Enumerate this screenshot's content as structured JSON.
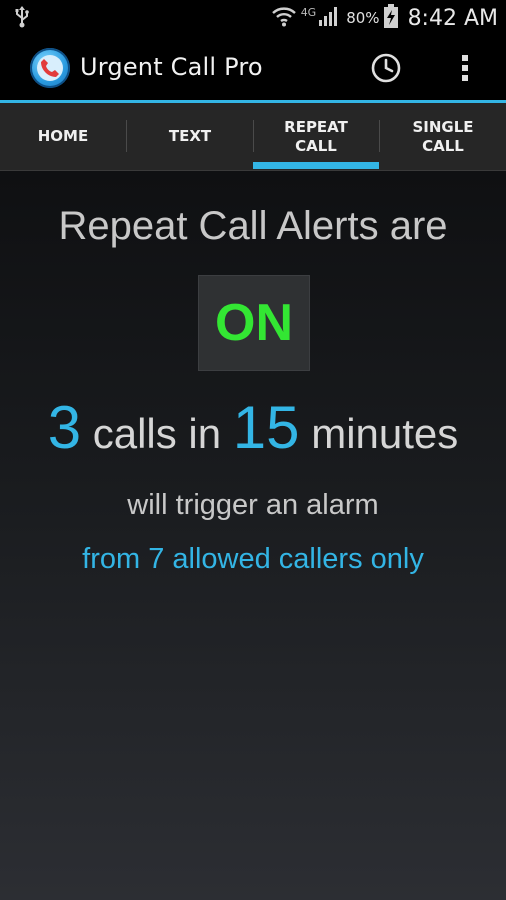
{
  "status_bar": {
    "network": "4G",
    "battery": "80%",
    "time": "8:42 AM"
  },
  "action_bar": {
    "title": "Urgent Call Pro",
    "icons": [
      "phone-app-icon",
      "history-icon",
      "overflow-menu-icon"
    ]
  },
  "tabs": [
    {
      "label": "HOME",
      "selected": false
    },
    {
      "label": "TEXT",
      "selected": false
    },
    {
      "label": "REPEAT\nCALL",
      "selected": true
    },
    {
      "label": "SINGLE\nCALL",
      "selected": false
    }
  ],
  "main": {
    "headline": "Repeat Call Alerts are",
    "status": "ON",
    "calls_count": "3",
    "calls_in_text": " calls in ",
    "minutes_count": "15",
    "minutes_text": " minutes",
    "trigger_text": "will trigger an alarm",
    "allowed_text": "from 7 allowed callers only"
  },
  "colors": {
    "accent": "#33b5e5",
    "status_on": "#33e633",
    "background_top": "#0f1012",
    "background_bottom": "#2c2e33"
  }
}
